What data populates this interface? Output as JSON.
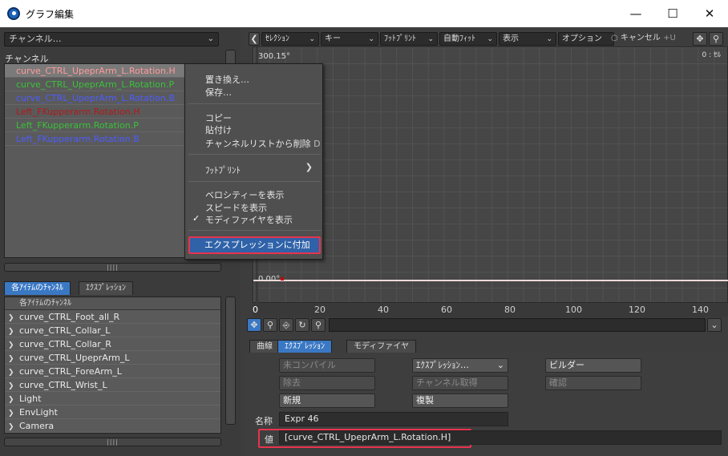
{
  "window": {
    "title": "グラフ編集"
  },
  "left": {
    "channel_dropdown": "チャンネル…",
    "channel_heading": "チャンネル",
    "channels": [
      {
        "label": "curve_CTRL_UpeprArm_L.Rotation.H",
        "color": "#ff9a9a"
      },
      {
        "label": "curve_CTRL_UpeprArm_L.Rotation.P",
        "color": "#39c239"
      },
      {
        "label": "curve_CTRL_UpeprArm_L.Rotation.B",
        "color": "#4c5cff"
      },
      {
        "label": "Left_FKupperarm.Rotation.H",
        "color": "#b01a1a"
      },
      {
        "label": "Left_FKupperarm.Rotation.P",
        "color": "#39c239"
      },
      {
        "label": "Left_FKupperarm.Rotation.B",
        "color": "#4c5cff"
      }
    ],
    "tabs": [
      "各ｱｲﾃﾑのﾁｬﾝﾈﾙ",
      "ｴｸｽﾌﾟﾚｯｼｮﾝ"
    ],
    "items_header": "各ｱｲﾃﾑのﾁｬﾝﾈﾙ",
    "items": [
      "curve_CTRL_Foot_all_R",
      "curve_CTRL_Collar_L",
      "curve_CTRL_Collar_R",
      "curve_CTRL_UpeprArm_L",
      "curve_CTRL_ForeArm_L",
      "curve_CTRL_Wrist_L",
      "Light",
      "EnvLight",
      "Camera"
    ]
  },
  "context_menu": {
    "replace": "置き換え…",
    "save": "保存…",
    "copy": "コピー",
    "paste": "貼付け",
    "remove": "チャンネルリストから削除",
    "remove_shortcut": "D",
    "footprint": "ﾌｯﾄﾌﾟﾘﾝﾄ",
    "show_velocity": "ベロシティーを表示",
    "show_speed": "スピードを表示",
    "show_modifier": "モディファイヤを表示",
    "checkmark": "✓",
    "attach_expression": "エクスプレッションに付加"
  },
  "toolbar": {
    "selection": "ｾﾚｸｼｮﾝ",
    "key": "キー",
    "footprint": "ﾌｯﾄﾌﾟﾘﾝﾄ",
    "autofit": "自動ﾌｨｯﾄ",
    "display": "表示",
    "options": "オプション",
    "cancel": "キャンセル",
    "cancel_shortcut": "+U"
  },
  "graph": {
    "y_top": "300.15°",
    "y_zero": "0.00°",
    "corner": "0 : ｾﾙ",
    "ticks": [
      "0",
      "20",
      "40",
      "60",
      "80",
      "100",
      "120",
      "140"
    ]
  },
  "bottom": {
    "tabs": [
      "曲線",
      "ｴｸｽﾌﾟﾚｯｼｮﾝ",
      "モディファイヤ"
    ],
    "uncompiled": "未コンパイル",
    "expression_dropdown": "ｴｸｽﾌﾟﾚｯｼｮﾝ…",
    "builder": "ビルダー",
    "remove": "除去",
    "get_channel": "チャンネル取得",
    "confirm": "確認",
    "new": "新規",
    "duplicate": "複製",
    "name_label": "名称",
    "name_value": "Expr 46",
    "value_label": "値",
    "value_value": "[curve_CTRL_UpeprArm_L.Rotation.H]"
  }
}
